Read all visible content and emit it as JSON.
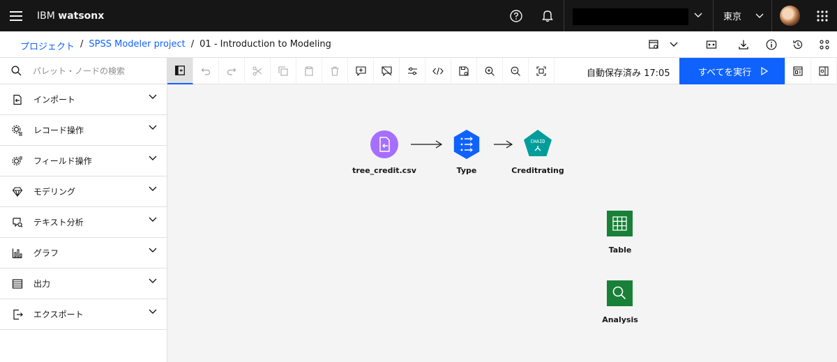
{
  "topbar": {
    "brand_prefix": "IBM",
    "brand_product": "watsonx",
    "region": "東京",
    "icons": [
      "menu-icon",
      "help-icon",
      "notification-icon",
      "chevron-down-icon",
      "app-switcher-icon"
    ]
  },
  "breadcrumb": {
    "items": [
      "プロジェクト",
      "SPSS Modeler project",
      "01 - Introduction to Modeling"
    ],
    "separator": "/"
  },
  "header_actions": [
    "flow-settings-icon",
    "chevron-down-icon",
    "runtime-icon",
    "download-icon",
    "info-icon",
    "history-icon",
    "branch-icon"
  ],
  "palette": {
    "search_placeholder": "パレット・ノードの検索",
    "categories": [
      {
        "label": "インポート",
        "icon": "import-icon"
      },
      {
        "label": "レコード操作",
        "icon": "record-ops-icon"
      },
      {
        "label": "フィールド操作",
        "icon": "field-ops-icon"
      },
      {
        "label": "モデリング",
        "icon": "diamond-icon"
      },
      {
        "label": "テキスト分析",
        "icon": "text-analysis-icon"
      },
      {
        "label": "グラフ",
        "icon": "chart-icon"
      },
      {
        "label": "出力",
        "icon": "output-icon"
      },
      {
        "label": "エクスポート",
        "icon": "export-icon"
      }
    ]
  },
  "toolbar": {
    "autosave": "自動保存済み 17:05",
    "run_all": "すべてを実行"
  },
  "canvas": {
    "nodes": [
      {
        "label": "tree_credit.csv",
        "kind": "import",
        "color": "#a56eff"
      },
      {
        "label": "Type",
        "kind": "type",
        "color": "#0f62fe"
      },
      {
        "label": "Creditrating",
        "kind": "chaid",
        "color": "#009d9a",
        "badge": "CHAID"
      },
      {
        "label": "Table",
        "kind": "table",
        "color": "#198038"
      },
      {
        "label": "Analysis",
        "kind": "analysis",
        "color": "#198038"
      }
    ]
  },
  "colors": {
    "topbar_bg": "#161616",
    "accent": "#0f62fe",
    "canvas_bg": "#f4f4f4"
  }
}
